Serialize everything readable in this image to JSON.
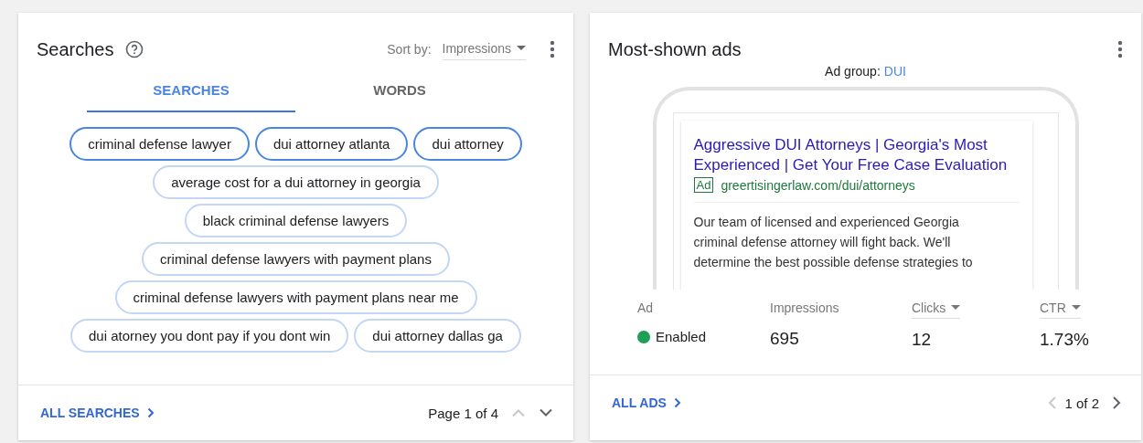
{
  "searches_card": {
    "title": "Searches",
    "sort": {
      "label": "Sort by:",
      "value": "Impressions"
    },
    "tabs": [
      {
        "label": "SEARCHES",
        "selected": true
      },
      {
        "label": "WORDS",
        "selected": false
      }
    ],
    "chips": [
      {
        "text": "criminal defense lawyer",
        "strong": true
      },
      {
        "text": "dui attorney atlanta",
        "strong": true
      },
      {
        "text": "dui attorney",
        "strong": true
      },
      {
        "text": "average cost for a dui attorney in georgia",
        "strong": false
      },
      {
        "text": "black criminal defense lawyers",
        "strong": false
      },
      {
        "text": "criminal defense lawyers with payment plans",
        "strong": false
      },
      {
        "text": "criminal defense lawyers with payment plans near me",
        "strong": false
      },
      {
        "text": "dui atorney you dont pay if you dont win",
        "strong": false
      },
      {
        "text": "dui attorney dallas ga",
        "strong": false
      }
    ],
    "footer_link": "ALL SEARCHES",
    "pager": {
      "text": "Page 1 of 4",
      "prev_disabled": true,
      "next_disabled": false
    }
  },
  "ads_card": {
    "title": "Most-shown ads",
    "ad_group_label": "Ad group:",
    "ad_group": "DUI",
    "ad": {
      "headline": "Aggressive DUI Attorneys | Georgia's Most Experienced | Get Your Free Case Evaluation",
      "badge": "Ad",
      "url": "greertisingerlaw.com/dui/attorneys",
      "description": "Our team of licensed and experienced Georgia criminal defense attorney will fight back. We'll determine the best possible defense strategies to"
    },
    "columns": [
      {
        "label": "Ad",
        "sortable": false
      },
      {
        "label": "Impressions",
        "sortable": false
      },
      {
        "label": "Clicks",
        "sortable": true
      },
      {
        "label": "CTR",
        "sortable": true
      }
    ],
    "row": {
      "status": "Enabled",
      "color": "#1e9e57",
      "impressions": "695",
      "clicks": "12",
      "ctr": "1.73%"
    },
    "footer_link": "ALL ADS",
    "pager": {
      "text": "1 of 2",
      "prev_disabled": true,
      "next_disabled": false
    }
  }
}
